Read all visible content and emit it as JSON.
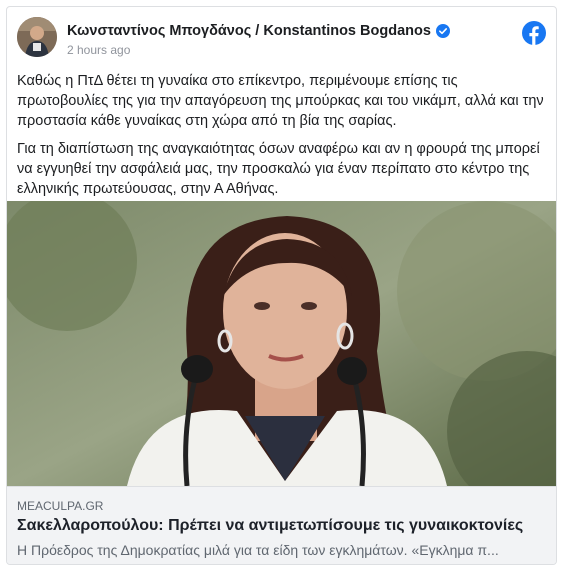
{
  "post": {
    "author": "Κωνσταντίνος Μπογδάνος / Konstantinos Bogdanos",
    "timestamp": "2 hours ago",
    "paragraphs": [
      "Καθώς η ΠτΔ θέτει τη γυναίκα στο επίκεντρο, περιμένουμε επίσης τις πρωτοβουλίες της για την απαγόρευση της μπούρκας και του νικάμπ, αλλά και την προστασία κάθε γυναίκας στη χώρα από τη βία της σαρίας.",
      "Για τη διαπίστωση της αναγκαιότητας όσων αναφέρω και αν η φρουρά της μπορεί να εγγυηθεί την ασφάλειά μας, την προσκαλώ για έναν περίπατο στο κέντρο της ελληνικής πρωτεύουσας, στην Α Αθήνας."
    ],
    "icons": {
      "verified": "verified-badge-icon",
      "platform": "facebook-logo-icon"
    },
    "colors": {
      "facebook_blue": "#1877f2",
      "link_bg": "#f2f3f5"
    }
  },
  "link_preview": {
    "domain": "MEACULPA.GR",
    "title": "Σακελλαροπούλου: Πρέπει να αντιμετωπίσουμε τις γυναικοκτονίες",
    "description": "Η Πρόεδρος της Δημοκρατίας μιλά για τα είδη των εγκλημάτων. «Εγκλημα π..."
  }
}
